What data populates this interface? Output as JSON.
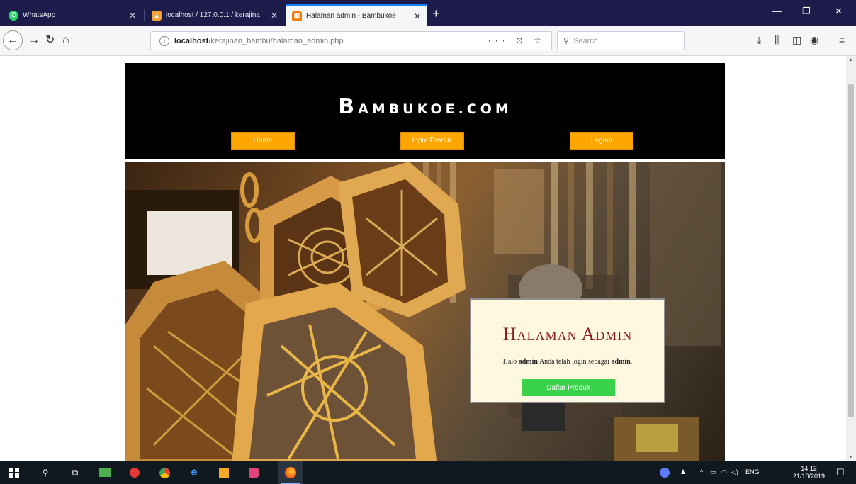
{
  "browser": {
    "tabs": [
      {
        "title": "WhatsApp",
        "active": false
      },
      {
        "title": "localhost / 127.0.0.1 / kerajina",
        "active": false
      },
      {
        "title": "Halaman admin - Bambukoe",
        "active": true
      }
    ],
    "url": {
      "host": "localhost",
      "path": "/kerajinan_bambu/halaman_admin.php"
    },
    "search_placeholder": "Search",
    "url_actions": "··· ⊙ ☆"
  },
  "site": {
    "logo_first": "B",
    "logo_rest": "AMBUKOE.COM",
    "nav": {
      "home": "Home",
      "input_produk": "Input Produk",
      "logout": "Logout"
    }
  },
  "admin_panel": {
    "title": "Halaman Admin",
    "msg_prefix": "Halo ",
    "user": "admin",
    "msg_middle": " Anda telah login sebagai ",
    "role": "admin",
    "msg_suffix": ".",
    "button": "Daftar Produk"
  },
  "taskbar": {
    "language": "ENG",
    "time": "14:12",
    "date": "21/10/2019"
  },
  "colors": {
    "nav_button": "#ffa500",
    "admin_title": "#8b1a1a",
    "daftar_button": "#3ad24a",
    "tabbar": "#1c1b4a"
  }
}
